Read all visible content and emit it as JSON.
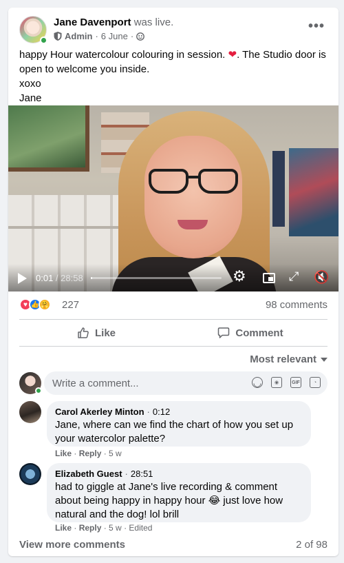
{
  "post": {
    "author": "Jane Davenport",
    "status": "was live.",
    "role": "Admin",
    "date": "6 June",
    "caption_line1": "happy Hour watercolour colouring in session.",
    "caption_line1_tail": ". The Studio door is open to welcome you inside.",
    "caption_line2": "xoxo",
    "caption_line3": "Jane",
    "more_icon": "more-horizontal-icon"
  },
  "video": {
    "current_time": "0:01",
    "separator": " / ",
    "duration": "28:58",
    "progress": 0.0006
  },
  "reactions": {
    "count": "227",
    "comments": "98 comments"
  },
  "actions": {
    "like": "Like",
    "comment": "Comment"
  },
  "sort": {
    "label": "Most relevant"
  },
  "composer": {
    "placeholder": "Write a comment..."
  },
  "comments": [
    {
      "name": "Carol Akerley Minton",
      "timestamp": "0:12",
      "text": "Jane, where can we find the chart of how you set up your watercolor palette?",
      "like": "Like",
      "reply": "Reply",
      "age": "5 w",
      "edited": ""
    },
    {
      "name": "Elizabeth Guest",
      "timestamp": "28:51",
      "text_before": "had to giggle at Jane's live recording & comment about being happy in happy hour",
      "emoji": "😂",
      "text_after": " just love how natural and the dog! lol brill",
      "like": "Like",
      "reply": "Reply",
      "age": "5 w",
      "edited": "Edited"
    }
  ],
  "footer": {
    "view_more": "View more comments",
    "page_count": "2 of 98"
  },
  "colors": {
    "accent": "#1877f2",
    "love": "#f33e58",
    "online": "#31a24c",
    "muted_text": "#65676b"
  }
}
